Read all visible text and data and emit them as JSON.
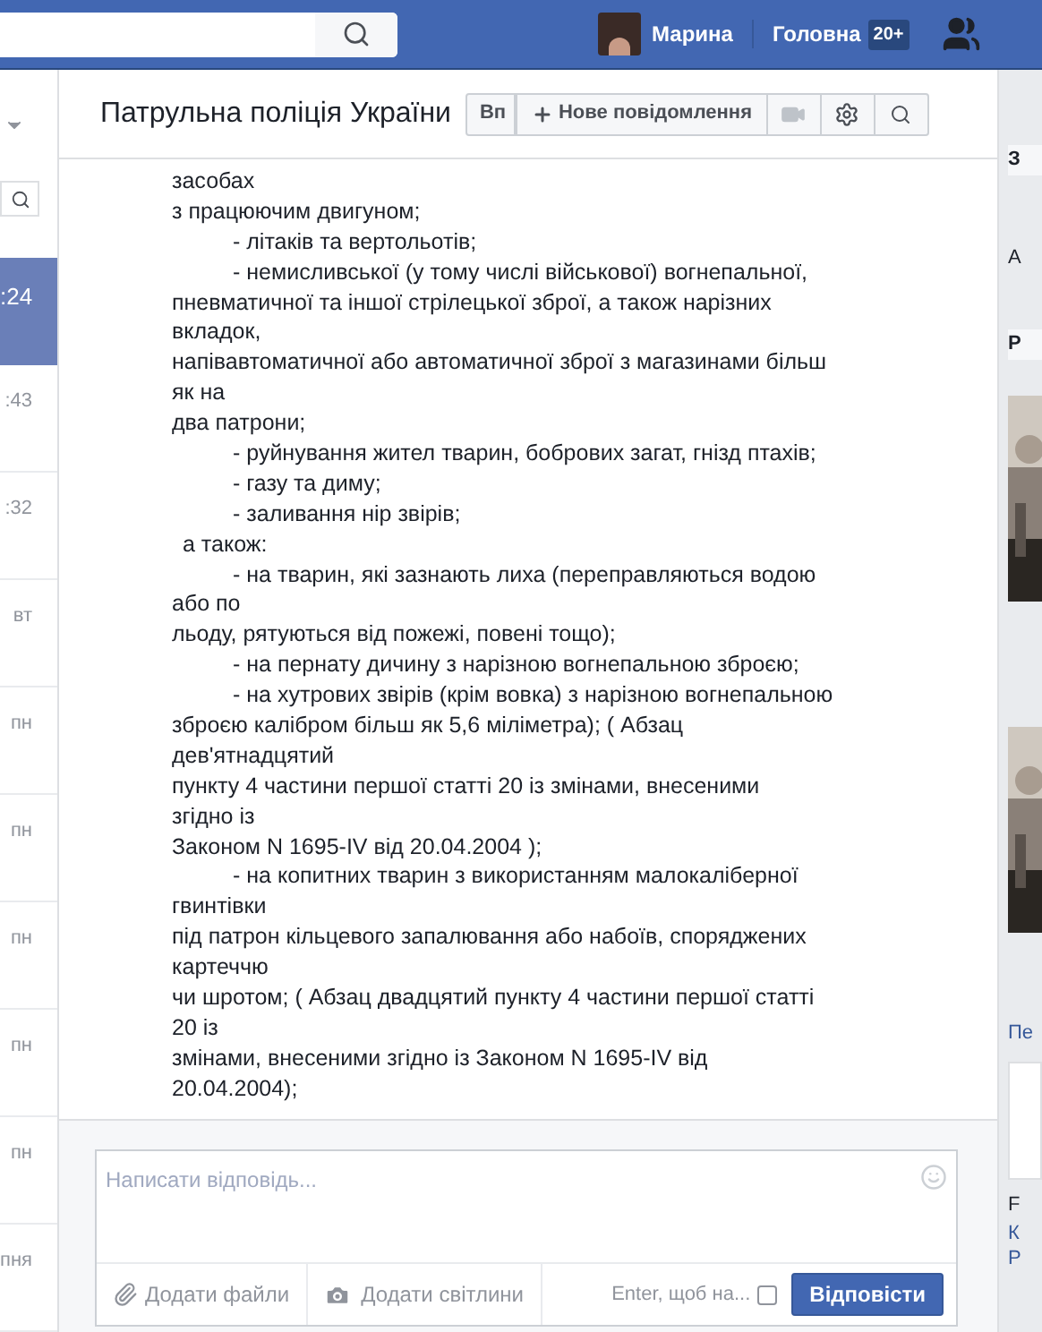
{
  "topbar": {
    "user": "Марина",
    "home": "Головна",
    "badge": "20+"
  },
  "conversations": [
    {
      "time": ":24",
      "selected": true
    },
    {
      "time": ":43",
      "selected": false
    },
    {
      "time": ":32",
      "selected": false
    },
    {
      "time": "вт",
      "selected": false
    },
    {
      "time": "пн",
      "selected": false
    },
    {
      "time": "пн",
      "selected": false
    },
    {
      "time": "пн",
      "selected": false
    },
    {
      "time": "пн",
      "selected": false
    },
    {
      "time": "пн",
      "selected": false
    },
    {
      "time": "пня",
      "selected": false
    }
  ],
  "header": {
    "title": "Патрульна поліція України",
    "hidden_button": "Вп",
    "new_message": "Нове повідомлення"
  },
  "message_lines": [
    {
      "kind": "plain",
      "text": "засобах"
    },
    {
      "kind": "plain",
      "text": "з працюючим двигуном;"
    },
    {
      "kind": "item",
      "text": "- літаків та вертольотів;"
    },
    {
      "kind": "item",
      "text": "- немисливської (у тому числі військової) вогнепальної,"
    },
    {
      "kind": "plain",
      "text": "пневматичної та іншої стрілецької зброї, а також нарізних"
    },
    {
      "kind": "plain",
      "text": "вкладок,"
    },
    {
      "kind": "plain",
      "text": "напівавтоматичної або автоматичної зброї з магазинами більш"
    },
    {
      "kind": "plain",
      "text": "як на"
    },
    {
      "kind": "plain",
      "text": "два патрони;"
    },
    {
      "kind": "item",
      "text": "- руйнування жител тварин, бобрових загат, гнізд птахів;"
    },
    {
      "kind": "item",
      "text": "- газу та диму;"
    },
    {
      "kind": "item",
      "text": "- заливання нір звірів;"
    },
    {
      "kind": "sub",
      "text": "а також:"
    },
    {
      "kind": "item",
      "text": "- на тварин, які зазнають лиха (переправляються водою"
    },
    {
      "kind": "plain",
      "text": "або по"
    },
    {
      "kind": "plain",
      "text": "льоду, рятуються від пожежі, повені тощо);"
    },
    {
      "kind": "item",
      "text": "- на пернату дичину з нарізною вогнепальною зброєю;"
    },
    {
      "kind": "item",
      "text": "- на хутрових звірів (крім вовка) з нарізною вогнепальною"
    },
    {
      "kind": "plain",
      "text": "зброєю калібром більш як 5,6 міліметра); ( Абзац"
    },
    {
      "kind": "plain",
      "text": "дев'ятнадцятий"
    },
    {
      "kind": "plain",
      "text": "пункту 4 частини першої статті 20 із змінами, внесеними"
    },
    {
      "kind": "plain",
      "text": "згідно із"
    },
    {
      "kind": "plain",
      "text": "Законом N 1695-IV від 20.04.2004 );"
    },
    {
      "kind": "item",
      "text": "- на копитних тварин з використанням малокаліберної"
    },
    {
      "kind": "plain",
      "text": "гвинтівки"
    },
    {
      "kind": "plain",
      "text": "під патрон кільцевого запалювання або набоїв, споряджених"
    },
    {
      "kind": "plain",
      "text": "картеччю"
    },
    {
      "kind": "plain",
      "text": "чи шротом; ( Абзац двадцятий пункту 4 частини першої статті"
    },
    {
      "kind": "plain",
      "text": "20 із"
    },
    {
      "kind": "plain",
      "text": "змінами, внесеними згідно із Законом N 1695-IV від"
    },
    {
      "kind": "plain",
      "text": "20.04.2004);"
    }
  ],
  "composer": {
    "placeholder": "Написати відповідь...",
    "attach": "Додати файли",
    "photos": "Додати світлини",
    "enter_label": "Enter, щоб на...",
    "enter_checked": false,
    "send": "Відповісти"
  },
  "right_sidebar": {
    "heading_1": "З",
    "text_1": "А",
    "heading_2": "Р",
    "link": "Пе",
    "text_2": "F",
    "text_3": "К",
    "text_4": "Р"
  }
}
